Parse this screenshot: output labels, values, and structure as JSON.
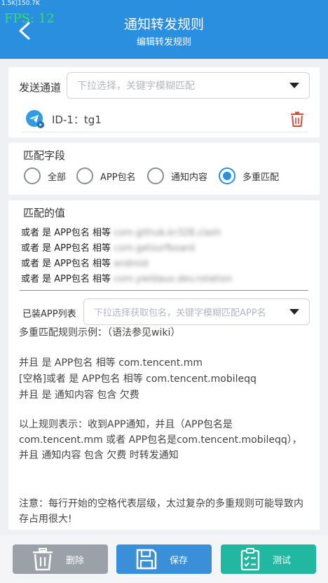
{
  "status": {
    "net_speed": "1.5K|150.7K",
    "fps": "FPS: 12"
  },
  "header": {
    "title": "通知转发规则",
    "subtitle": "编辑转发规则"
  },
  "sender": {
    "label": "发送通道",
    "placeholder": "下拉选择，关键字模糊匹配",
    "item": "ID-1：tg1"
  },
  "match_field": {
    "label": "匹配字段",
    "options": [
      "全部",
      "APP包名",
      "通知内容",
      "多重匹配"
    ],
    "selected": "多重匹配"
  },
  "match_value": {
    "label": "匹配的值",
    "lines": [
      {
        "prefix": "或者 是 APP包名 相等",
        "value": "com.github.kr328.clash"
      },
      {
        "prefix": "或者 是 APP包名 相等",
        "value": "com.getsurfboard"
      },
      {
        "prefix": "或者 是 APP包名 相等",
        "value": "android"
      },
      {
        "prefix": "或者 是 APP包名 相等",
        "value": "com.yieldaux.dev.rotation"
      }
    ]
  },
  "installed_apps": {
    "label": "已装APP列表",
    "placeholder": "下拉选择获取包名，关键字模糊匹配APP名"
  },
  "example": {
    "heading": "多重匹配规则示例：（语法参见wiki）",
    "rule1": "并且 是 APP包名 相等 com.tencent.mm",
    "rule2": "[空格]或者 是 APP包名 相等 com.tencent.mobileqq",
    "rule3": "并且 是 通知内容 包含 欠费",
    "explain": "以上规则表示：收到APP通知，并且（APP包名是com.tencent.mm 或者 APP包名是com.tencent.mobileqq），并且 通知内容 包含 欠费 时转发通知",
    "note": "注意：每行开始的空格代表层级，太过复杂的多重规则可能导致内存占用很大!"
  },
  "buttons": {
    "delete": "删除",
    "save": "保存",
    "test": "测试",
    "colors": {
      "delete": "#9aa1a9",
      "save": "#3b8fd8",
      "test": "#21b7a1"
    }
  },
  "colors": {
    "accent": "#2b8fe0",
    "danger": "#d84a3a"
  }
}
